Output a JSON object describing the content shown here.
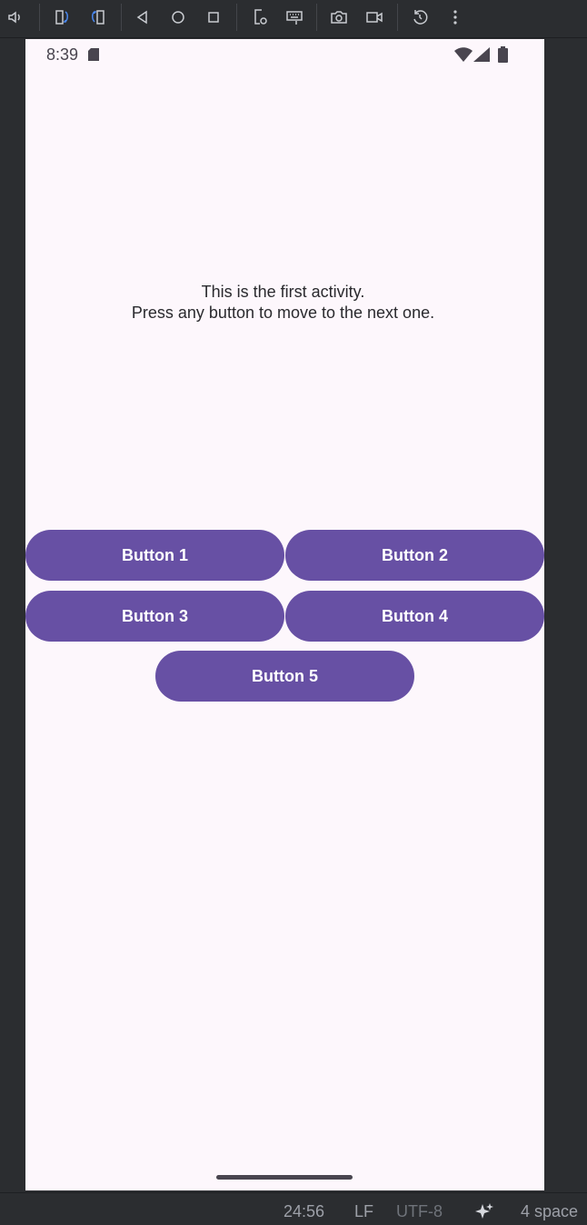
{
  "toolbar": {
    "icons": [
      "volume-icon",
      "rotate-left-icon",
      "rotate-right-icon",
      "back-icon",
      "home-icon",
      "overview-icon",
      "device-settings-icon",
      "keyboard-icon",
      "camera-icon",
      "video-record-icon",
      "reset-icon",
      "more-icon"
    ]
  },
  "device": {
    "status_time": "8:39"
  },
  "app": {
    "message_line1": "This is the first activity.",
    "message_line2": "Press any button to move to the next one.",
    "buttons": [
      "Button 1",
      "Button 2",
      "Button 3",
      "Button 4",
      "Button 5"
    ],
    "accent_color": "#6750a4",
    "background_color": "#fdf7fc"
  },
  "ide_status": {
    "position": "24:56",
    "line_separator": "LF",
    "encoding": "UTF-8",
    "indent": "4 space"
  }
}
